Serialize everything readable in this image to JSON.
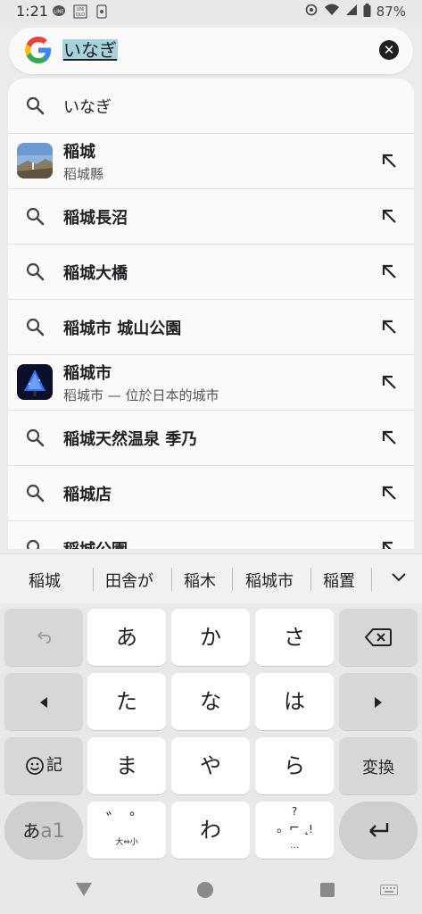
{
  "status": {
    "time": "1:21",
    "battery": "87%",
    "icons": [
      "line-icon",
      "uniqlo-icon",
      "notification-icon"
    ]
  },
  "search": {
    "query": "いなぎ"
  },
  "results": [
    {
      "type": "search",
      "label": "いなぎ",
      "bold": false
    },
    {
      "type": "entity",
      "label": "稲城",
      "sub": "稻城縣",
      "thumb": "landscape"
    },
    {
      "type": "search",
      "label": "稲城長沼",
      "bold": true
    },
    {
      "type": "search",
      "label": "稲城大橋",
      "bold": true
    },
    {
      "type": "search",
      "label": "稲城市 城山公園",
      "bold": true
    },
    {
      "type": "entity",
      "label": "稲城市",
      "sub": "稻城市 — 位於日本的城市",
      "thumb": "tree-lights"
    },
    {
      "type": "search",
      "label": "稲城天然温泉 季乃",
      "bold": true
    },
    {
      "type": "search",
      "label": "稲城店",
      "bold": true
    },
    {
      "type": "search",
      "label": "稲城公園",
      "bold": true
    }
  ],
  "suggestions": [
    "稲城",
    "田舎が",
    "稲木",
    "稲城市",
    "稲置"
  ],
  "keyboard": {
    "row1": [
      "あ",
      "か",
      "さ"
    ],
    "row2": [
      "た",
      "な",
      "は"
    ],
    "row3": [
      "ま",
      "や",
      "ら"
    ],
    "row4": [
      "わ"
    ],
    "emoji_label": "記",
    "convert_label": "変換",
    "mode_label_a": "あ",
    "mode_label_b": "a1",
    "dakuten_bottom": "大⇔小",
    "punct_top": "?",
    "punct_bottom": "…",
    "punct_right": "!"
  }
}
